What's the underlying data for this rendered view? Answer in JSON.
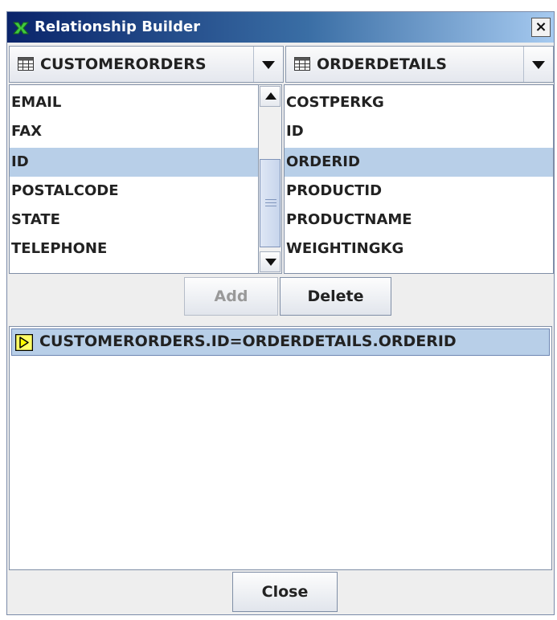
{
  "window": {
    "title": "Relationship Builder",
    "close_glyph": "×",
    "title_icon": "relationship-icon"
  },
  "left_table": {
    "selected": "CUSTOMERORDERS",
    "icon": "table-icon",
    "columns": [
      "EMAIL",
      "FAX",
      "ID",
      "POSTALCODE",
      "STATE",
      "TELEPHONE"
    ],
    "selected_column": "ID"
  },
  "right_table": {
    "selected": "ORDERDETAILS",
    "icon": "table-icon",
    "columns": [
      "COSTPERKG",
      "ID",
      "ORDERID",
      "PRODUCTID",
      "PRODUCTNAME",
      "WEIGHTINGKG"
    ],
    "selected_column": "ORDERID"
  },
  "buttons": {
    "add": "Add",
    "add_enabled": false,
    "delete": "Delete",
    "close": "Close"
  },
  "relationships": [
    {
      "text": "CUSTOMERORDERS.ID=ORDERDETAILS.ORDERID",
      "icon": "relationship-arrow-icon",
      "selected": true
    }
  ],
  "colors": {
    "selection": "#b8cfe8",
    "titlebar_start": "#0a246a",
    "titlebar_end": "#a6caf0",
    "window_bg": "#eeeeee"
  }
}
